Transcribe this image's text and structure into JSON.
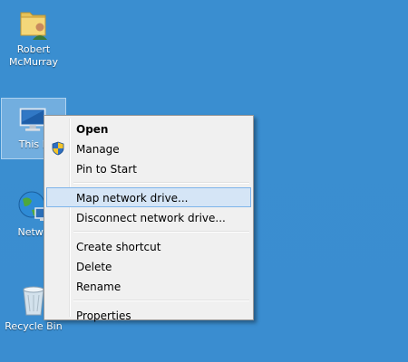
{
  "desktop": {
    "background_color": "#3a8ed0",
    "icons": [
      {
        "label": "Robert\nMcMurray",
        "icon": "user-folder-icon"
      },
      {
        "label": "This P",
        "icon": "computer-icon"
      },
      {
        "label": "Netwo",
        "icon": "network-globe-icon"
      },
      {
        "label": "Recycle Bin",
        "icon": "recycle-bin-icon"
      }
    ]
  },
  "context_menu": {
    "items": [
      {
        "label": "Open",
        "default": true
      },
      {
        "label": "Manage",
        "icon": "uac-shield-icon"
      },
      {
        "label": "Pin to Start"
      },
      {
        "label": "Map network drive...",
        "highlighted": true
      },
      {
        "label": "Disconnect network drive..."
      },
      {
        "label": "Create shortcut"
      },
      {
        "label": "Delete"
      },
      {
        "label": "Rename"
      },
      {
        "label": "Properties"
      }
    ]
  },
  "colors": {
    "menu_background": "#f0f0f0",
    "menu_highlight": "#d5e5f6",
    "menu_highlight_border": "#7eb4ea"
  }
}
